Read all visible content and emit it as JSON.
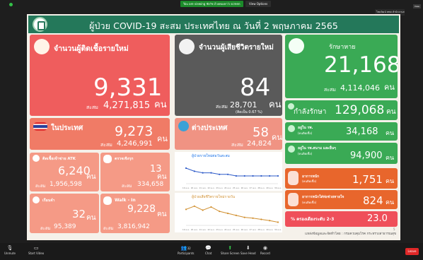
{
  "zoom": {
    "banner": "You are viewing ชัยวัช ถ้วยทองหา's screen",
    "view_options": "View Options",
    "speaker": "ไชยวัฒน์ หทษ สำนักงานสาธารณสุข",
    "view_label": "View"
  },
  "header": {
    "title": "ผู้ป่วย COVID-19 สะสม ประเทศไทย ณ วันที่ 2 พฤษภาคม 2565"
  },
  "new_cases": {
    "label": "จำนวนผู้ติดเชื้อรายใหม่",
    "value": "9,331",
    "unit": "คน",
    "cum_label": "สะสม",
    "cum_value": "4,271,815",
    "cum_unit": "คน"
  },
  "deaths": {
    "label": "จำนวนผู้เสียชีวิตรายใหม่",
    "value": "84",
    "unit": "คน",
    "cum_label": "สะสม",
    "cum_value": "28,701",
    "cum_unit": "คน",
    "rate": "(คิดเป็น 0.67 %)"
  },
  "recovered": {
    "label": "รักษาหาย",
    "value": "21,168",
    "unit": "คน",
    "cum_label": "สะสม",
    "cum_value": "4,114,046",
    "cum_unit": "คน"
  },
  "domestic": {
    "label": "ในประเทศ",
    "value": "9,273",
    "unit": "คน",
    "cum_label": "สะสม",
    "cum_value": "4,246,991"
  },
  "abroad": {
    "label": "ต่างประเทศ",
    "value": "58",
    "unit": "คน",
    "cum_label": "สะสม",
    "cum_value": "24,824"
  },
  "treating": {
    "label": "กำลังรักษา",
    "value": "129,068",
    "unit": "คน"
  },
  "hospital": {
    "label": "อยู่ใน รพ.",
    "sub": "(คนติดเชื้อ)",
    "value": "34,168",
    "unit": "คน"
  },
  "field_hosp": {
    "label": "อยู่ใน รพ.สนาม และอื่นๆ",
    "sub": "(คนติดเชื้อ)",
    "value": "94,900",
    "unit": "คน"
  },
  "severe": {
    "label": "อาการหนัก",
    "sub": "(คนติดเชื้อ)",
    "value": "1,751",
    "unit": "คน"
  },
  "ventilator": {
    "label": "อาการหนักใส่ท่อช่วยหายใจ",
    "sub": "(คนติดเชื้อ)",
    "value": "824",
    "unit": "คน"
  },
  "vaccine": {
    "label": "% ครองเตียงระดับ 2-3",
    "value": "23.0"
  },
  "atk": {
    "label": "ติดเชื้อเข้าข่าย ATK",
    "value": "6,240",
    "unit": "คน",
    "cum_label": "สะสม",
    "cum_value": "1,956,598"
  },
  "active_search": {
    "label": "ตรวจเชิงรุก",
    "value": "13",
    "unit": "คน",
    "cum_label": "สะสม",
    "cum_value": "334,658"
  },
  "prison": {
    "label": "เรือนจำ",
    "value": "32",
    "unit": "คน",
    "cum_label": "สะสม",
    "cum_value": "95,389"
  },
  "walkin": {
    "label": "Walk - In",
    "value": "9,228",
    "unit": "คน",
    "cum_label": "สะสม",
    "cum_value": "3,816,942"
  },
  "chart_data": [
    {
      "type": "line",
      "title": "ผู้ป่วยรายใหม่ต่อวันสะสม",
      "categories": [
        "19 เม.ย.",
        "20 เม.ย.",
        "21 เม.ย.",
        "22 เม.ย.",
        "23 เม.ย.",
        "24 เม.ย.",
        "25 เม.ย.",
        "26 เม.ย.",
        "27 เม.ย.",
        "28 เม.ย.",
        "29 เม.ย.",
        "30 เม.ย."
      ],
      "values": [
        1.0,
        0.8,
        0.7,
        0.7,
        0.6,
        0.6,
        0.5,
        0.5,
        0.5,
        0.5,
        0.5,
        0.5
      ],
      "ylim": [
        0,
        1.5
      ],
      "color": "#2f5cc9"
    },
    {
      "type": "line",
      "title": "ผู้ป่วยเสียชีวิตรายใหม่รายวัน",
      "categories": [
        "19 เม.ย.",
        "20 เม.ย.",
        "21 เม.ย.",
        "22 เม.ย.",
        "23 เม.ย.",
        "24 เม.ย.",
        "25 เม.ย.",
        "26 เม.ย.",
        "27 เม.ย.",
        "28 เม.ย.",
        "29 เม.ย.",
        "30 เม.ย."
      ],
      "values": [
        120,
        128,
        118,
        126,
        115,
        110,
        105,
        100,
        98,
        95,
        92,
        88
      ],
      "ylim": [
        80,
        140
      ],
      "color": "#d19030"
    }
  ],
  "footer": {
    "note": "แหล่งข้อมูลและจัดทำโดย : กรมควบคุมโรค กระทรวงสาธารณสุข",
    "page": "5"
  },
  "toolbar": {
    "unmute": "Unmute",
    "video": "Start Video",
    "participants": "Participants",
    "participant_count": "32",
    "chat": "Chat",
    "share": "Share Screen",
    "record": "Record",
    "save": "Save Head",
    "leave": "Leave"
  },
  "colors": {
    "header": "#24785a",
    "new_cases": "#ef5d5d",
    "deaths": "#5a5a5a",
    "recovered": "#3aaa55",
    "domestic": "#f07b66",
    "abroad": "#f09383",
    "orange": "#e8662c"
  }
}
